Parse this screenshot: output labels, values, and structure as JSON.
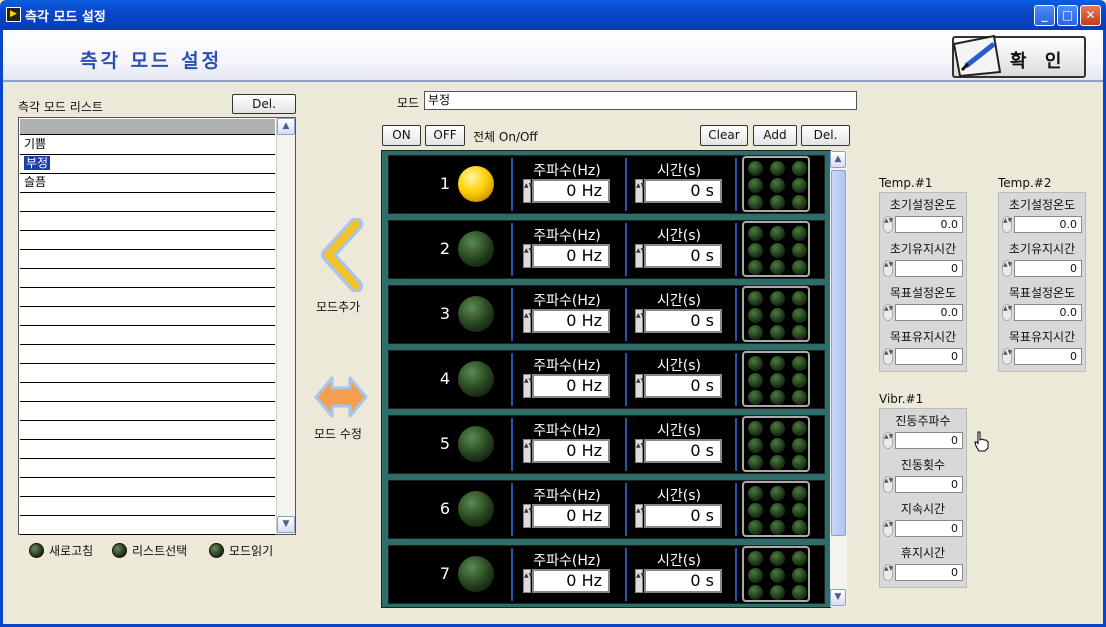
{
  "window": {
    "title": "측각 모드 설정",
    "minimize": "_",
    "maximize": "□",
    "close": "✕"
  },
  "header": {
    "title": "측각 모드 설정",
    "confirm": "확 인"
  },
  "list": {
    "label": "측각 모드 리스트",
    "del": "Del.",
    "items": [
      "기쁨",
      "부정",
      "슬픔"
    ],
    "selected_index": 1
  },
  "leds_bottom": [
    {
      "label": "새로고침"
    },
    {
      "label": "리스트선택"
    },
    {
      "label": "모드읽기"
    }
  ],
  "actions": {
    "add_mode": "모드추가",
    "edit_mode": "모드 수정"
  },
  "mode": {
    "label": "모드",
    "value": "부정"
  },
  "toolbar": {
    "on": "ON",
    "off": "OFF",
    "all_onoff": "전체 On/Off",
    "clear": "Clear",
    "add": "Add",
    "del": "Del."
  },
  "channels": [
    {
      "num": "1",
      "freq_label": "주파수(Hz)",
      "freq": "0 Hz",
      "time_label": "시간(s)",
      "time": "0 s",
      "led_on": true
    },
    {
      "num": "2",
      "freq_label": "주파수(Hz)",
      "freq": "0 Hz",
      "time_label": "시간(s)",
      "time": "0 s",
      "led_on": false
    },
    {
      "num": "3",
      "freq_label": "주파수(Hz)",
      "freq": "0 Hz",
      "time_label": "시간(s)",
      "time": "0 s",
      "led_on": false
    },
    {
      "num": "4",
      "freq_label": "주파수(Hz)",
      "freq": "0 Hz",
      "time_label": "시간(s)",
      "time": "0 s",
      "led_on": false
    },
    {
      "num": "5",
      "freq_label": "주파수(Hz)",
      "freq": "0 Hz",
      "time_label": "시간(s)",
      "time": "0 s",
      "led_on": false
    },
    {
      "num": "6",
      "freq_label": "주파수(Hz)",
      "freq": "0 Hz",
      "time_label": "시간(s)",
      "time": "0 s",
      "led_on": false
    },
    {
      "num": "7",
      "freq_label": "주파수(Hz)",
      "freq": "0 Hz",
      "time_label": "시간(s)",
      "time": "0 s",
      "led_on": false
    }
  ],
  "temp1": {
    "title": "Temp.#1",
    "fields": [
      {
        "label": "초기설정온도",
        "value": "0.0"
      },
      {
        "label": "초기유지시간",
        "value": "0"
      },
      {
        "label": "목표설정온도",
        "value": "0.0"
      },
      {
        "label": "목표유지시간",
        "value": "0"
      }
    ]
  },
  "temp2": {
    "title": "Temp.#2",
    "fields": [
      {
        "label": "초기설정온도",
        "value": "0.0"
      },
      {
        "label": "초기유지시간",
        "value": "0"
      },
      {
        "label": "목표설정온도",
        "value": "0.0"
      },
      {
        "label": "목표유지시간",
        "value": "0"
      }
    ]
  },
  "vibr1": {
    "title": "Vibr.#1",
    "fields": [
      {
        "label": "진동주파수",
        "value": "0"
      },
      {
        "label": "진동횟수",
        "value": "0"
      },
      {
        "label": "지속시간",
        "value": "0"
      },
      {
        "label": "휴지시간",
        "value": "0"
      }
    ]
  }
}
